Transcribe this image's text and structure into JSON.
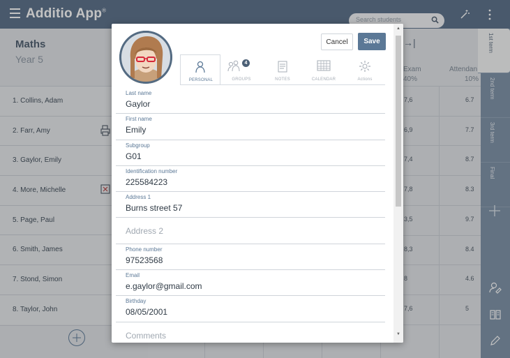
{
  "app": {
    "brand": "Additio App",
    "brand_mark": "®"
  },
  "search": {
    "placeholder": "Search students"
  },
  "class": {
    "subject": "Maths",
    "year": "Year 5"
  },
  "students": [
    {
      "name": "1. Collins, Adam",
      "exam": "7,6",
      "attendance": "6.7",
      "icon": ""
    },
    {
      "name": "2. Farr, Amy",
      "exam": "6,9",
      "attendance": "7.7",
      "icon": "printer-icon"
    },
    {
      "name": "3. Gaylor, Emily",
      "exam": "7,4",
      "attendance": "8.7",
      "icon": ""
    },
    {
      "name": "4. More, Michelle",
      "exam": "7,8",
      "attendance": "8.3",
      "icon": "image-x-icon"
    },
    {
      "name": "5. Page, Paul",
      "exam": "3,5",
      "attendance": "9.7",
      "icon": ""
    },
    {
      "name": "6. Smith, James",
      "exam": "8,3",
      "attendance": "8.4",
      "icon": ""
    },
    {
      "name": "7. Stond, Simon",
      "exam": "8",
      "attendance": "4.6",
      "icon": ""
    },
    {
      "name": "8. Taylor, John",
      "exam": "7,6",
      "attendance": "5",
      "icon": ""
    }
  ],
  "columns": [
    {
      "title": "Exam",
      "weight": "40%"
    },
    {
      "title": "Attendan",
      "weight": "10%"
    }
  ],
  "terms": [
    "1st term",
    "2nd term",
    "3rd term",
    "Final"
  ],
  "modal": {
    "cancel": "Cancel",
    "save": "Save",
    "tabs": [
      {
        "label": "PERSONAL",
        "icon": "person-icon"
      },
      {
        "label": "GROUPS",
        "icon": "group-icon",
        "badge": "4"
      },
      {
        "label": "NOTES",
        "icon": "notes-icon"
      },
      {
        "label": "CALENDAR",
        "icon": "calendar-icon"
      },
      {
        "label": "Actions",
        "icon": "gear-icon"
      }
    ],
    "fields": [
      {
        "label": "Last name",
        "value": "Gaylor"
      },
      {
        "label": "First name",
        "value": "Emily"
      },
      {
        "label": "Subgroup",
        "value": "G01"
      },
      {
        "label": "Identification number",
        "value": "225584223"
      },
      {
        "label": "Address 1",
        "value": "Burns street 57"
      },
      {
        "label": "",
        "placeholder": "Address 2"
      },
      {
        "label": "Phone number",
        "value": "97523568"
      },
      {
        "label": "Email",
        "value": "e.gaylor@gmail.com"
      },
      {
        "label": "Birthday",
        "value": "08/05/2001"
      },
      {
        "label": "",
        "placeholder": "Comments"
      }
    ]
  },
  "colors": {
    "topbar": "#566d87",
    "accent": "#5b7896",
    "rail": "#7b8fa6"
  }
}
